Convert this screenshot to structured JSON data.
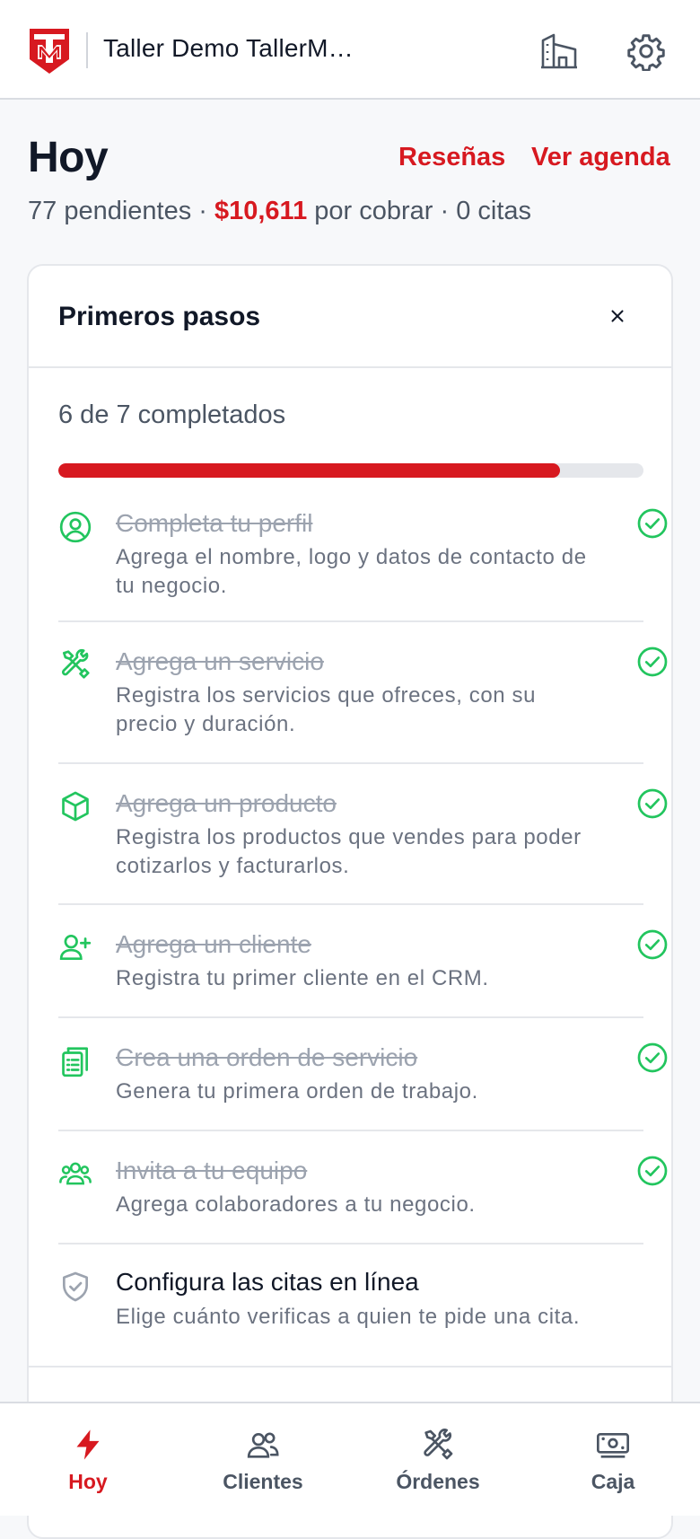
{
  "header": {
    "title": "Taller Demo TallerM…",
    "logo_icon": "tallermatic-logo",
    "branch_icon": "building-icon",
    "settings_icon": "gear-icon"
  },
  "summary": {
    "title": "Hoy",
    "reviews_link": "Reseñas",
    "agenda_link": "Ver agenda",
    "pending": "77 pendientes · ",
    "amount": "$10,611",
    "to_collect": " por cobrar · 0 citas"
  },
  "onboarding": {
    "title": "Primeros pasos",
    "close_icon": "close-icon",
    "progress_text": "6 de 7 completados",
    "progress_fraction": 0.857,
    "steps": [
      {
        "title": "Completa tu perfil",
        "desc": "Agrega el nombre, logo y datos de contacto de tu negocio.",
        "icon": "user-circle-icon",
        "done": true
      },
      {
        "title": "Agrega un servicio",
        "desc": "Registra los servicios que ofreces, con su precio y duración.",
        "icon": "tools-icon",
        "done": true
      },
      {
        "title": "Agrega un producto",
        "desc": "Registra los productos que vendes para poder cotizarlos y facturarlos.",
        "icon": "box-icon",
        "done": true
      },
      {
        "title": "Agrega un cliente",
        "desc": "Registra tu primer cliente en el CRM.",
        "icon": "user-plus-icon",
        "done": true
      },
      {
        "title": "Crea una orden de servicio",
        "desc": "Genera tu primera orden de trabajo.",
        "icon": "clipboard-icon",
        "done": true
      },
      {
        "title": "Invita a tu equipo",
        "desc": "Agrega colaboradores a tu negocio.",
        "icon": "team-icon",
        "done": true
      },
      {
        "title": "Configura las citas en línea",
        "desc": "Elige cuánto verificas a quien te pide una cita.",
        "icon": "shield-check-icon",
        "done": false
      }
    ]
  },
  "nav": {
    "home": "Hoy",
    "clients": "Clientes",
    "orders": "Órdenes",
    "cash": "Caja",
    "active": "home"
  },
  "colors": {
    "accent": "#d71920",
    "success": "#22c55e",
    "muted": "#9ca3af"
  }
}
